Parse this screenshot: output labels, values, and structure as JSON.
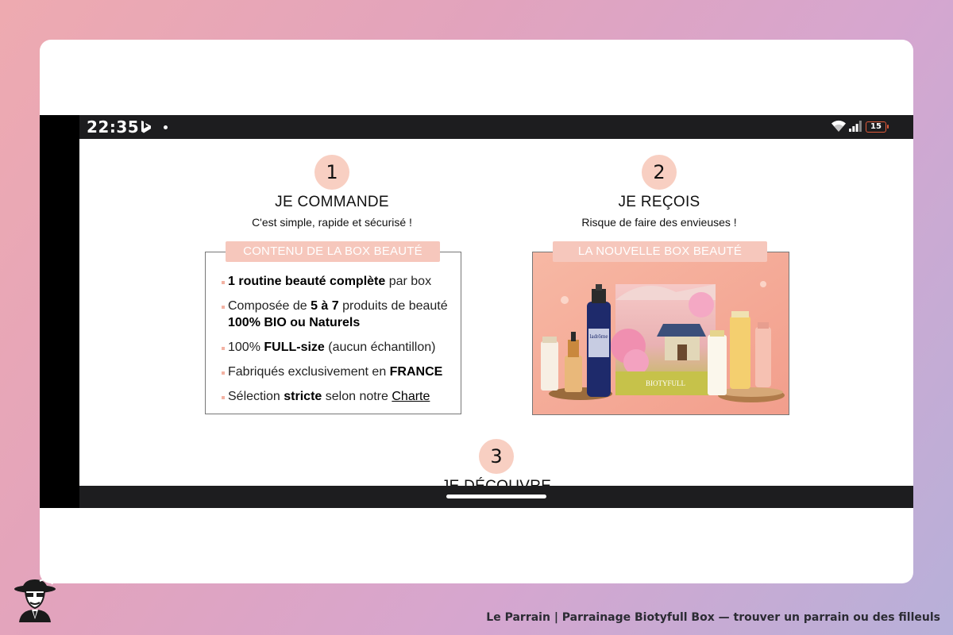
{
  "status": {
    "time": "22:35",
    "battery": "15",
    "icons": [
      "bing-icon",
      "notification-dot-icon",
      "wifi-icon",
      "signal-icon",
      "battery-icon"
    ]
  },
  "steps": [
    {
      "number": "1",
      "title": "JE COMMANDE",
      "subtitle": "C'est simple, rapide et sécurisé !"
    },
    {
      "number": "2",
      "title": "JE REÇOIS",
      "subtitle": "Risque de faire des envieuses !"
    },
    {
      "number": "3",
      "title": "JE DÉCOUVRE"
    }
  ],
  "box_content": {
    "tab": "CONTENU DE LA BOX BEAUTÉ",
    "items": [
      {
        "b1": "1 routine beauté complète",
        "t1": " par box"
      },
      {
        "t1": "Composée de ",
        "b1": "5 à 7",
        "t2": " produits de beauté ",
        "b2": "100% BIO ou Naturels"
      },
      {
        "t1": "100% ",
        "b1": "FULL-size",
        "t2": " (aucun échantillon)"
      },
      {
        "t1": "Fabriqués exclusivement en ",
        "b1": "FRANCE"
      },
      {
        "t1": "Sélection ",
        "b1": "stricte",
        "t2": " selon notre ",
        "link": "Charte"
      }
    ]
  },
  "new_box": {
    "tab": "LA NOUVELLE BOX BEAUTÉ",
    "bottle_label": "ladrôme",
    "box_brand": "BIOTYFULL"
  },
  "colors": {
    "accent_peach": "#f8cfc2",
    "tab_pink": "#f6c7bc",
    "status_bar": "#1d1d1f"
  },
  "footer": {
    "caption": "Le Parrain | Parrainage Biotyfull Box — trouver un parrain ou des filleuls",
    "logo_icon": "detective-hat-logo-icon"
  }
}
